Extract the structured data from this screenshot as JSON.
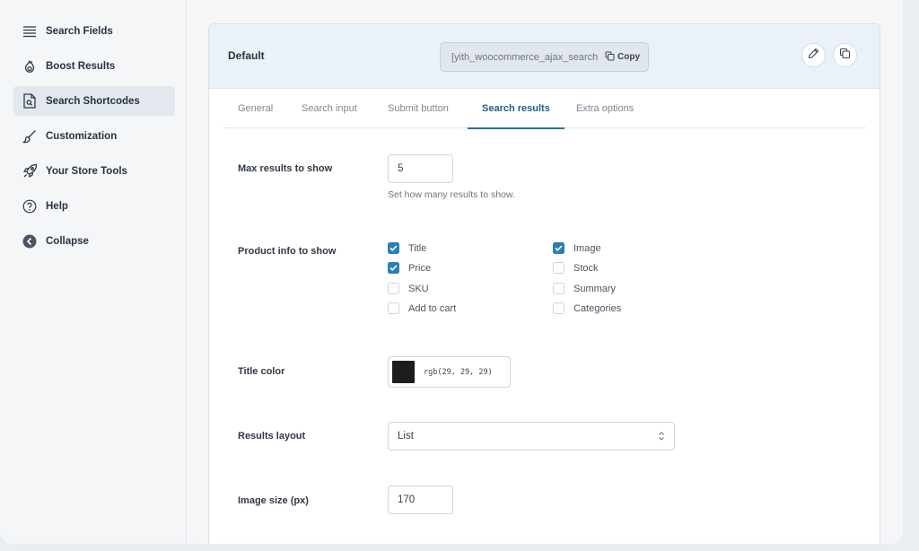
{
  "sidebar": {
    "items": [
      {
        "label": "Search Fields",
        "icon": "list-icon"
      },
      {
        "label": "Boost Results",
        "icon": "flame-icon"
      },
      {
        "label": "Search Shortcodes",
        "icon": "file-search-icon",
        "active": true
      },
      {
        "label": "Customization",
        "icon": "brush-icon"
      },
      {
        "label": "Your Store Tools",
        "icon": "rocket-icon"
      },
      {
        "label": "Help",
        "icon": "help-circle-icon"
      },
      {
        "label": "Collapse",
        "icon": "collapse-arrow-icon"
      }
    ]
  },
  "panel": {
    "title": "Default",
    "shortcode": "[yith_woocommerce_ajax_search",
    "copy_label": "Copy"
  },
  "tabs": [
    "General",
    "Search input",
    "Submit button",
    "Search results",
    "Extra options"
  ],
  "active_tab": "Search results",
  "form": {
    "max_results": {
      "label": "Max results to show",
      "value": "5",
      "help": "Set how many results to show."
    },
    "product_info": {
      "label": "Product info to show",
      "options": [
        {
          "label": "Title",
          "checked": true
        },
        {
          "label": "Price",
          "checked": true
        },
        {
          "label": "SKU",
          "checked": false
        },
        {
          "label": "Add to cart",
          "checked": false
        },
        {
          "label": "Image",
          "checked": true
        },
        {
          "label": "Stock",
          "checked": false
        },
        {
          "label": "Summary",
          "checked": false
        },
        {
          "label": "Categories",
          "checked": false
        }
      ]
    },
    "title_color": {
      "label": "Title color",
      "value": "rgb(29, 29, 29)",
      "swatch": "#1d1d1d"
    },
    "results_layout": {
      "label": "Results layout",
      "value": "List"
    },
    "image_size": {
      "label": "Image size (px)",
      "value": "170"
    }
  },
  "colors": {
    "accent": "#2c7fb0",
    "tab_active": "#1f5f88"
  }
}
